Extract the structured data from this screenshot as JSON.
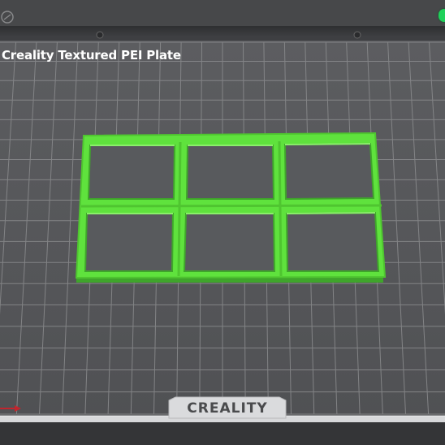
{
  "plate": {
    "title": "Creality Textured PEI Plate",
    "brand": "CREALITY"
  },
  "model": {
    "shape": "3x2 grid frame",
    "color": "#5fe23d"
  },
  "colors": {
    "background": "#48494b",
    "bed_surface": "#5a5b5e",
    "grid_lines": "#8d8e90",
    "status_indicator": "#1fd15a"
  },
  "icons": [
    "creality-logo-icon",
    "axis-x-arrow-icon",
    "mount-hole-icon"
  ]
}
